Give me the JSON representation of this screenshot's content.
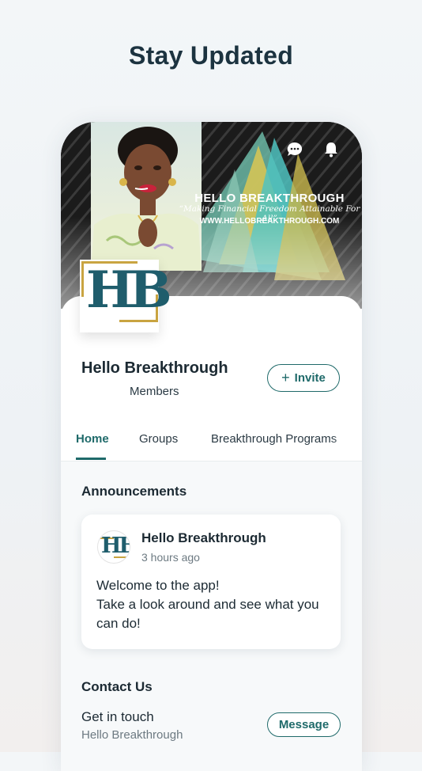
{
  "headline": "Stay Updated",
  "cover": {
    "title": "HELLO BREAKTHROUGH",
    "tagline": "“Making Financial Freedom Attainable For All”",
    "url": "WWW.HELLOBREAKTHROUGH.COM",
    "logo_letters": "HB"
  },
  "header_icons": [
    "chat-icon",
    "bell-icon"
  ],
  "group": {
    "name": "Hello Breakthrough",
    "members_label": "Members",
    "invite_label": "Invite"
  },
  "tabs": [
    {
      "label": "Home",
      "active": true
    },
    {
      "label": "Groups",
      "active": false
    },
    {
      "label": "Breakthrough Programs",
      "active": false
    }
  ],
  "announcements": {
    "title": "Announcements",
    "post": {
      "author": "Hello Breakthrough",
      "time": "3 hours ago",
      "avatar_letters": "HB",
      "lines": [
        "Welcome to the app!",
        "Take a look around and see what you",
        "can do!"
      ]
    }
  },
  "contact": {
    "title": "Contact Us",
    "subtitle": "Get in touch",
    "name": "Hello Breakthrough",
    "message_label": "Message"
  },
  "colors": {
    "accent": "#1f6a6a",
    "logo_teal": "#1f5d6c",
    "logo_gold": "#c9a441"
  }
}
